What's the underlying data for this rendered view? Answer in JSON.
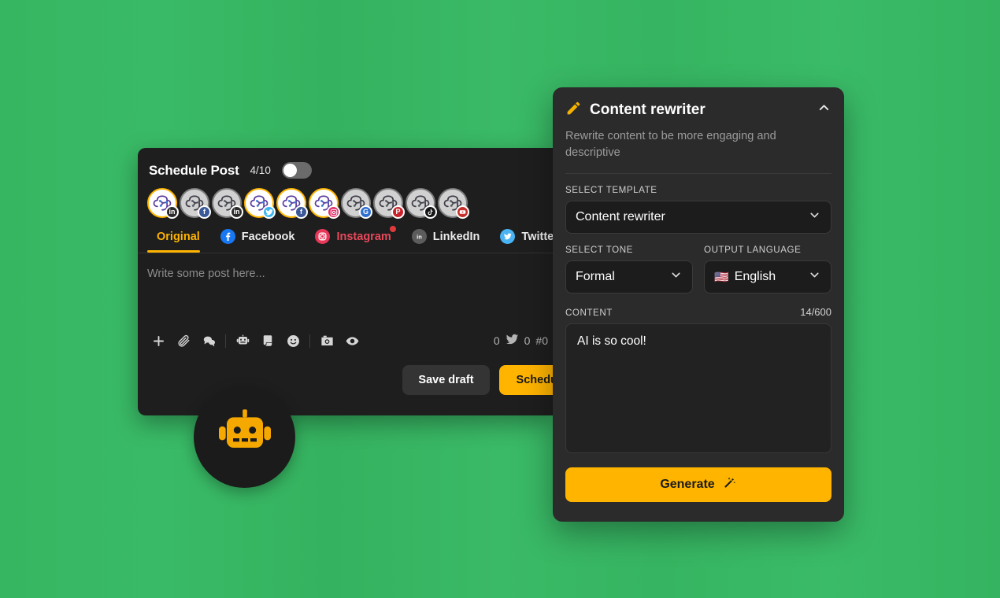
{
  "theme": {
    "background": "#38b863",
    "accent": "#ffb400",
    "panel_bg": "#2b2b2b",
    "card_bg": "#1e1e1e",
    "instagram_red": "#e8495a"
  },
  "schedule_card": {
    "title": "Schedule Post",
    "count": "4/10",
    "toggle_on": false,
    "accounts": [
      {
        "platform": "linkedin",
        "selected": true,
        "icon": "linkedin-icon"
      },
      {
        "platform": "facebook",
        "selected": false,
        "icon": "facebook-icon"
      },
      {
        "platform": "linkedin",
        "selected": false,
        "icon": "linkedin-icon"
      },
      {
        "platform": "twitter",
        "selected": true,
        "icon": "twitter-icon"
      },
      {
        "platform": "facebook",
        "selected": true,
        "icon": "facebook-icon"
      },
      {
        "platform": "instagram",
        "selected": true,
        "icon": "instagram-icon"
      },
      {
        "platform": "google",
        "selected": false,
        "icon": "google-icon"
      },
      {
        "platform": "pinterest",
        "selected": false,
        "icon": "pinterest-icon"
      },
      {
        "platform": "tiktok",
        "selected": false,
        "icon": "tiktok-icon"
      },
      {
        "platform": "youtube",
        "selected": false,
        "icon": "youtube-icon"
      }
    ],
    "tabs": [
      {
        "label": "Original",
        "active": true,
        "icon": null,
        "has_dot": false
      },
      {
        "label": "Facebook",
        "active": false,
        "icon": "facebook-icon",
        "has_dot": false
      },
      {
        "label": "Instagram",
        "active": false,
        "icon": "instagram-icon",
        "has_dot": true
      },
      {
        "label": "LinkedIn",
        "active": false,
        "icon": "linkedin-icon",
        "has_dot": false
      },
      {
        "label": "Twitter",
        "active": false,
        "icon": "twitter-icon",
        "has_dot": false
      }
    ],
    "editor": {
      "placeholder": "Write some post here...",
      "value": ""
    },
    "toolbar_icons": [
      "plus-icon",
      "paperclip-icon",
      "comment-icon",
      "robot-icon",
      "note-icon",
      "emoji-icon",
      "camera-icon",
      "eye-icon"
    ],
    "counters": {
      "characters": "0",
      "twitter_count": "0",
      "hashtag_count": "#0"
    },
    "save_draft_label": "Save draft",
    "schedule_label": "Schedule"
  },
  "fab": {
    "icon": "robot-icon"
  },
  "panel": {
    "icon": "pencil-icon",
    "title": "Content rewriter",
    "collapse_icon": "chevron-up-icon",
    "subtitle": "Rewrite content to be more engaging and descriptive",
    "template": {
      "label": "SELECT TEMPLATE",
      "value": "Content rewriter"
    },
    "tone": {
      "label": "SELECT TONE",
      "value": "Formal"
    },
    "language": {
      "label": "OUTPUT LANGUAGE",
      "value": "English",
      "flag": "🇺🇸"
    },
    "content": {
      "label": "CONTENT",
      "counter": "14/600",
      "value": "AI is so cool!"
    },
    "generate_label": "Generate",
    "generate_icon": "magic-wand-icon"
  }
}
